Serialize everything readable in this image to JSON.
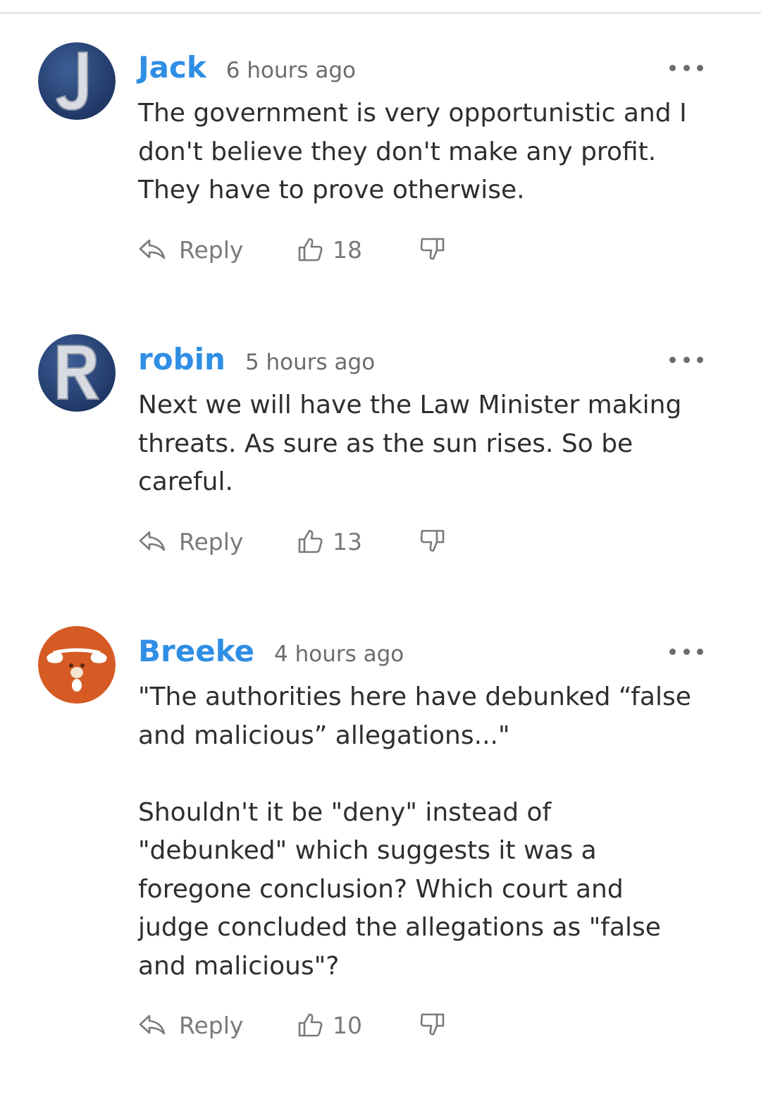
{
  "comments": [
    {
      "author": "Jack",
      "time": "6 hours ago",
      "avatar_letter": "J",
      "avatar_color": "#2b4a7e",
      "text": "The government is very opportunistic and I\ndon't believe they don't make any profit.\nThey have to prove otherwise.",
      "reply_label": "Reply",
      "likes": "18"
    },
    {
      "author": "robin",
      "time": "5 hours ago",
      "avatar_letter": "R",
      "avatar_color": "#2e4a80",
      "text": "Next we will have the Law Minister making\nthreats. As sure as the sun rises. So be\ncareful.",
      "reply_label": "Reply",
      "likes": "13"
    },
    {
      "author": "Breeke",
      "time": "4 hours ago",
      "avatar_letter": "",
      "avatar_color": "#d65a24",
      "text": "\"The authorities here have debunked “false\nand malicious” allegations...\"\n\nShouldn't it be \"deny\" instead of\n\"debunked\" which suggests it was a\nforegone conclusion? Which court and\njudge concluded the allegations as \"false\nand malicious\"?",
      "reply_label": "Reply",
      "likes": "10"
    }
  ],
  "colors": {
    "author": "#2f8ee5",
    "meta": "#6c6c6c",
    "text": "#2e2e2e"
  },
  "icons": [
    "reply-icon",
    "thumbs-up-icon",
    "thumbs-down-icon",
    "more-options-icon"
  ]
}
